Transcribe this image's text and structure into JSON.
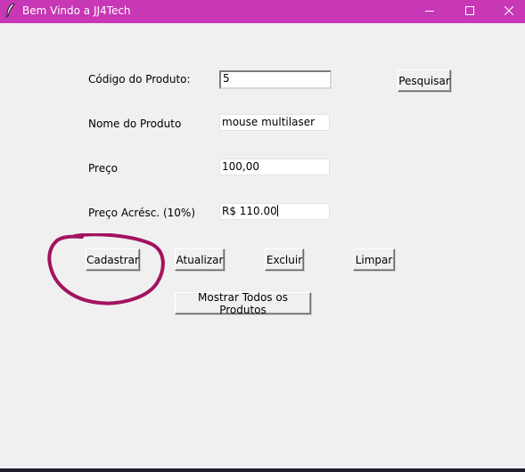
{
  "window": {
    "title": "Bem Vindo a JJ4Tech",
    "icon": "feather-icon",
    "titlebar_color": "#c837b5",
    "controls": {
      "minimize": "minimize-icon",
      "maximize": "maximize-icon",
      "close": "close-icon"
    }
  },
  "form": {
    "codigo": {
      "label": "Código do Produto:",
      "value": "5"
    },
    "nome": {
      "label": "Nome do Produto",
      "value": "mouse multilaser"
    },
    "preco": {
      "label": "Preço",
      "value": "100,00"
    },
    "preco_acresc": {
      "label": "Preço Acrésc. (10%)",
      "value": "R$ 110.00"
    }
  },
  "buttons": {
    "pesquisar": "Pesquisar",
    "cadastrar": "Cadastrar",
    "atualizar": "Atualizar",
    "excluir": "Excluir",
    "limpar": "Limpar",
    "mostrar_todos": "Mostrar Todos os Produtos"
  },
  "annotation": {
    "shape": "hand-drawn-circle",
    "color": "#a3125f",
    "target": "cadastrar-button"
  }
}
